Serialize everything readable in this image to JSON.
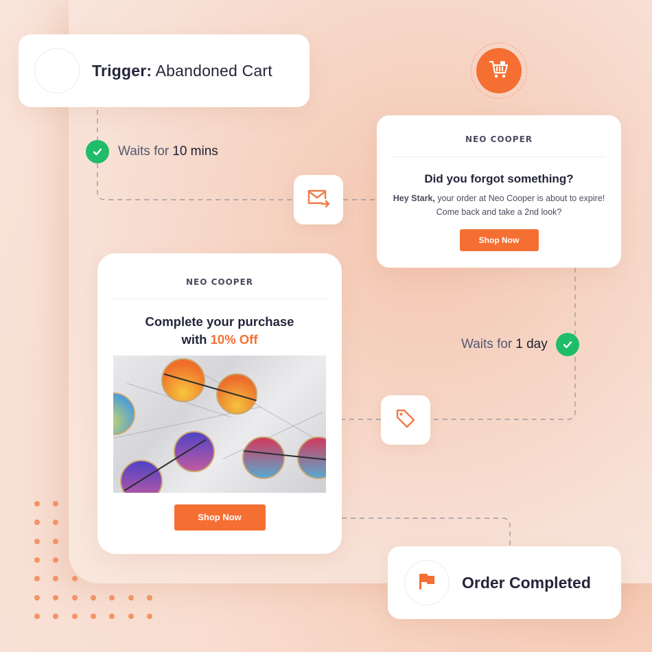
{
  "trigger": {
    "label": "Trigger:",
    "value": "Abandoned Cart"
  },
  "waits": [
    {
      "prefix": "Waits for",
      "value": "10 mins",
      "status": "completed"
    },
    {
      "prefix": "Waits for",
      "value": "1 day",
      "status": "completed"
    }
  ],
  "email_reminder": {
    "brand": "NEO COOPER",
    "heading": "Did you forgot something?",
    "body_name": "Hey Stark,",
    "body_rest": " your order at Neo Cooper is about to expire! Come back and take a 2nd look?",
    "button_label": "Shop Now"
  },
  "email_discount": {
    "brand": "NEO COOPER",
    "heading_line1": "Complete your purchase",
    "heading_with": "with ",
    "heading_accent": "10% Off",
    "image_alt": "Round tinted sunglasses on marble",
    "button_label": "Shop Now"
  },
  "completion": {
    "label": "Order Completed"
  },
  "icons": {
    "trigger": "empty-circle",
    "cart": "shopping-cart-icon",
    "email": "mail-send-icon",
    "discount": "tag-icon",
    "completion": "flag-icon",
    "wait": "check-circle-icon"
  },
  "colors": {
    "accent": "#f56f33",
    "success": "#1fbd6a",
    "text_dark": "#24253a",
    "text_muted": "#555870"
  }
}
